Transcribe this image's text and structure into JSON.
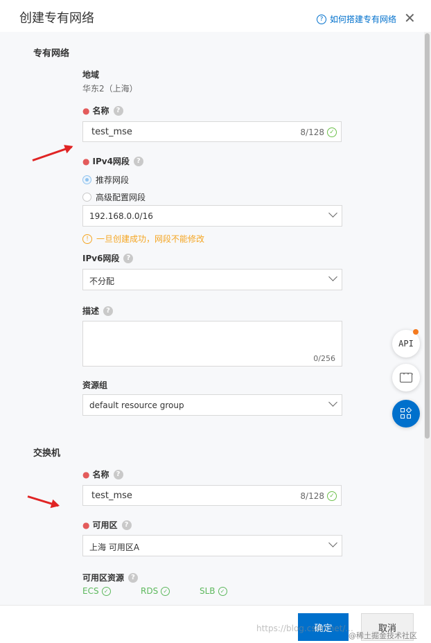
{
  "dialog": {
    "title": "创建专有网络",
    "help_link": "如何搭建专有网络",
    "close_symbol": "✕"
  },
  "vpc": {
    "section_title": "专有网络",
    "region_label": "地域",
    "region_value": "华东2（上海）",
    "name_label": "名称",
    "name_value": "test_mse",
    "name_count": "8/128",
    "ipv4_label": "IPv4网段",
    "ipv4_option_recommended": "推荐网段",
    "ipv4_option_advanced": "高级配置网段",
    "ipv4_selected": "192.168.0.0/16",
    "ipv4_warning": "一旦创建成功，网段不能修改",
    "ipv6_label": "IPv6网段",
    "ipv6_selected": "不分配",
    "desc_label": "描述",
    "desc_count": "0/256",
    "resource_group_label": "资源组",
    "resource_group_selected": "default resource group"
  },
  "vswitch": {
    "section_title": "交换机",
    "name_label": "名称",
    "name_value": "test_mse",
    "name_count": "8/128",
    "zone_label": "可用区",
    "zone_selected": "上海 可用区A",
    "zone_resources_label": "可用区资源",
    "zone_resources": [
      "ECS",
      "RDS",
      "SLB"
    ]
  },
  "floating": {
    "api_label": "API"
  },
  "footer": {
    "confirm": "确定",
    "cancel": "取消"
  },
  "watermark": {
    "url": "https://blog.csdn.net/...",
    "community": "@稀土掘金技术社区"
  },
  "colors": {
    "primary": "#0070cc",
    "required": "#e35b5b",
    "warning": "#f5a623",
    "success": "#5cb85c",
    "arrow": "#e02424"
  }
}
